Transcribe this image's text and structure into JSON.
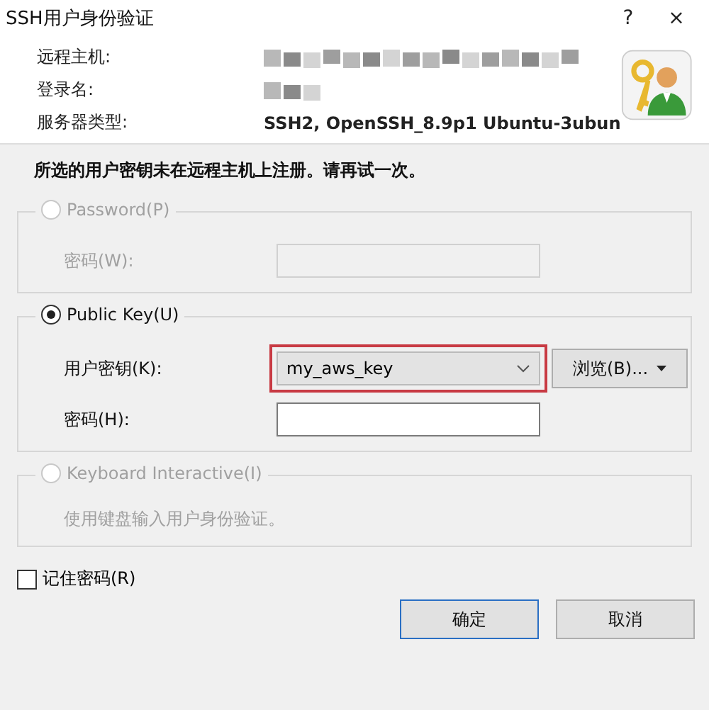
{
  "window": {
    "title": "SSH用户身份验证",
    "controls": [
      "?",
      "×"
    ]
  },
  "info": [
    {
      "label": "远程主机:",
      "kind": "redacted"
    },
    {
      "label": "登录名:",
      "kind": "redacted_short"
    },
    {
      "label": "服务器类型:",
      "kind": "text",
      "value": "SSH2, OpenSSH_8.9p1 Ubuntu-3ubun"
    }
  ],
  "message": "所选的用户密钥未在远程主机上注册。请再试一次。",
  "methods": [
    {
      "label": "Password(P)",
      "selected": false,
      "disabled": true,
      "fields": [
        {
          "kind": "input",
          "label": "密码(W):"
        }
      ]
    },
    {
      "label": "Public Key(U)",
      "selected": true,
      "disabled": false,
      "fields": [
        {
          "kind": "combo",
          "label": "用户密钥(K):",
          "value": "my_aws_key",
          "highlighted": true,
          "button": "浏览(B)..."
        },
        {
          "kind": "input",
          "label": "密码(H):"
        }
      ]
    },
    {
      "label": "Keyboard Interactive(I)",
      "selected": false,
      "disabled": true,
      "fields": [
        {
          "kind": "note",
          "label": "使用键盘输入用户身份验证。"
        }
      ]
    }
  ],
  "remember": {
    "label": "记住密码(R)",
    "checked": false
  },
  "buttons": [
    {
      "label": "确定",
      "default": true
    },
    {
      "label": "取消",
      "default": false
    }
  ]
}
